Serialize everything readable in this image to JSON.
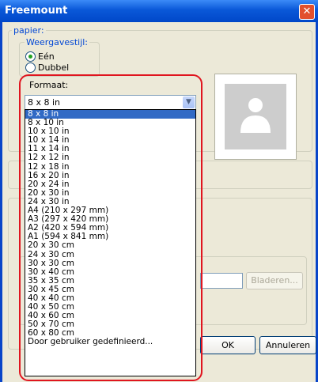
{
  "window": {
    "title": "Freemount"
  },
  "papier": {
    "group_label": "papier:",
    "weergavestijl_label": "Weergavestijl:",
    "radio_een": "Eén",
    "radio_dubbel": "Dubbel"
  },
  "formaat": {
    "label": "Formaat:",
    "selected": "8 x 8 in",
    "options": [
      "8 x 8 in",
      "8 x 10 in",
      "10 x 10 in",
      "10 x 14 in",
      "11 x 14 in",
      "12 x 12 in",
      "12 x 18 in",
      "16 x 20 in",
      "20 x 24 in",
      "20 x 30 in",
      "24 x 30 in",
      "A4 (210 x 297 mm)",
      "A3 (297 x 420 mm)",
      "A2 (420 x 594 mm)",
      "A1 (594 x 841 mm)",
      "20 x 30 cm",
      "24 x 30 cm",
      "30 x 30 cm",
      "30 x 40 cm",
      "35 x 35 cm",
      "30 x 45 cm",
      "40 x 40 cm",
      "40 x 50 cm",
      "40 x 60 cm",
      "50 x 70 cm",
      "60 x 80 cm",
      "Door gebruiker gedefinieerd..."
    ]
  },
  "browse_label": "Bladeren...",
  "ok_label": "OK",
  "cancel_label": "Annuleren"
}
